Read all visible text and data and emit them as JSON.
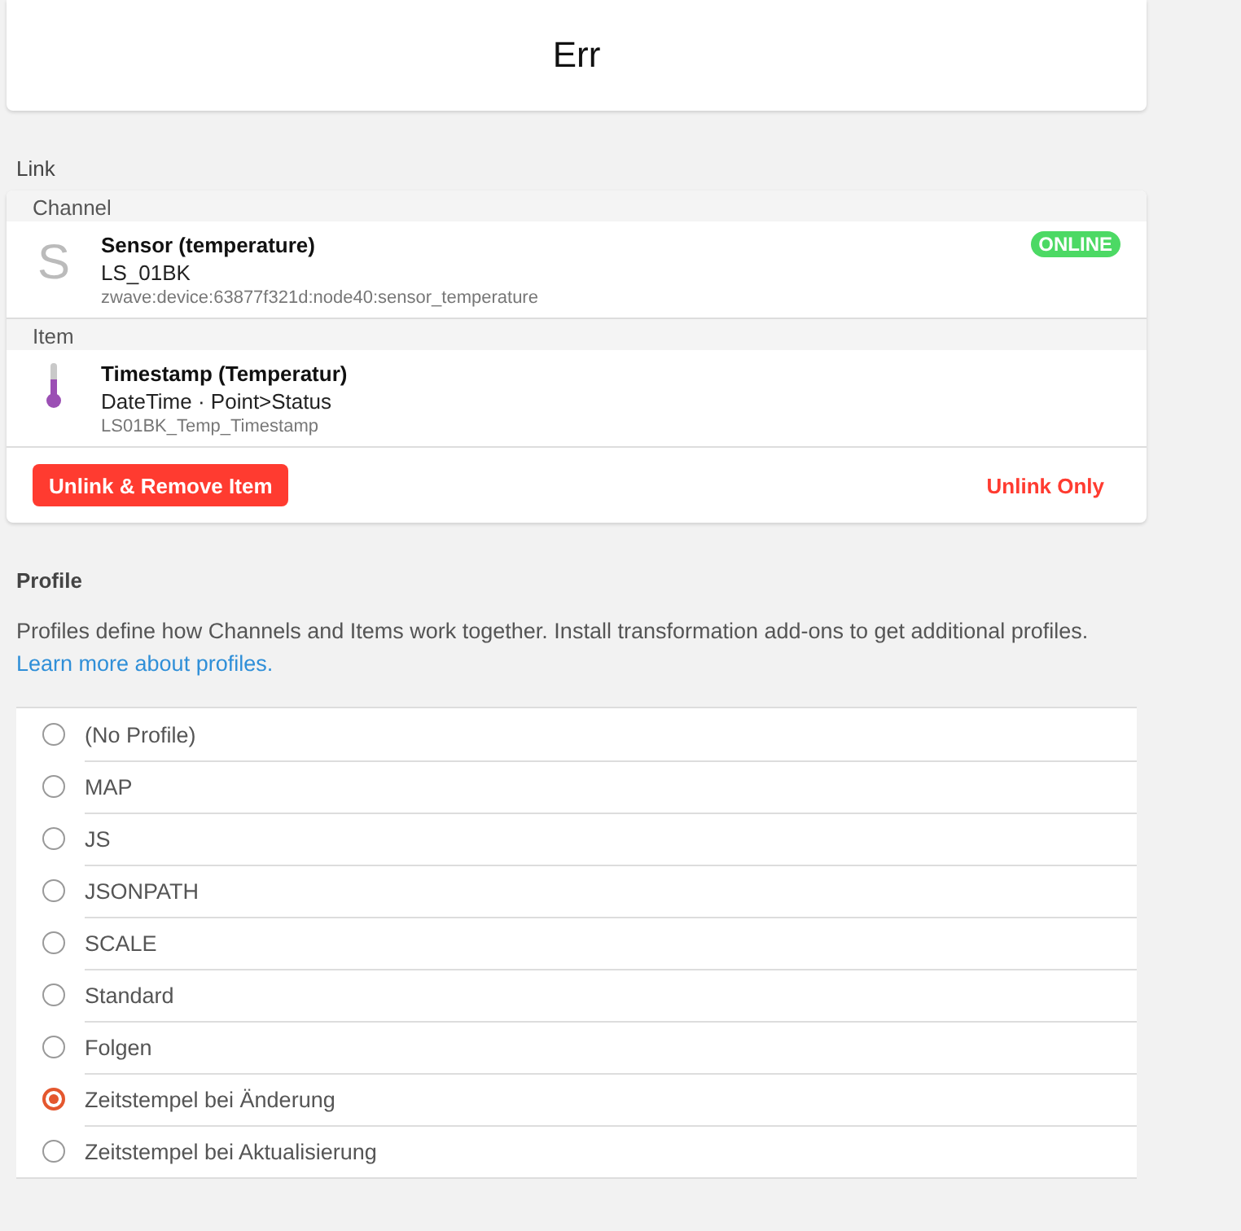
{
  "title": "Err",
  "link": {
    "heading": "Link",
    "channel": {
      "section": "Channel",
      "icon_letter": "S",
      "name": "Sensor (temperature)",
      "label": "LS_01BK",
      "uid": "zwave:device:63877f321d:node40:sensor_temperature",
      "status": "ONLINE"
    },
    "item": {
      "section": "Item",
      "name": "Timestamp (Temperatur)",
      "type": "DateTime · Point>Status",
      "uid": "LS01BK_Temp_Timestamp"
    },
    "buttons": [
      {
        "label": "Unlink & Remove Item",
        "kind": "filled"
      },
      {
        "label": "Unlink Only",
        "kind": "text"
      }
    ]
  },
  "profile": {
    "heading": "Profile",
    "description": "Profiles define how Channels and Items work together. Install transformation add-ons to get additional profiles.",
    "link": "Learn more about profiles.",
    "options": [
      {
        "label": "(No Profile)",
        "selected": false
      },
      {
        "label": "MAP",
        "selected": false
      },
      {
        "label": "JS",
        "selected": false
      },
      {
        "label": "JSONPATH",
        "selected": false
      },
      {
        "label": "SCALE",
        "selected": false
      },
      {
        "label": "Standard",
        "selected": false
      },
      {
        "label": "Folgen",
        "selected": false
      },
      {
        "label": "Zeitstempel bei Änderung",
        "selected": true
      },
      {
        "label": "Zeitstempel bei Aktualisierung",
        "selected": false
      }
    ]
  }
}
